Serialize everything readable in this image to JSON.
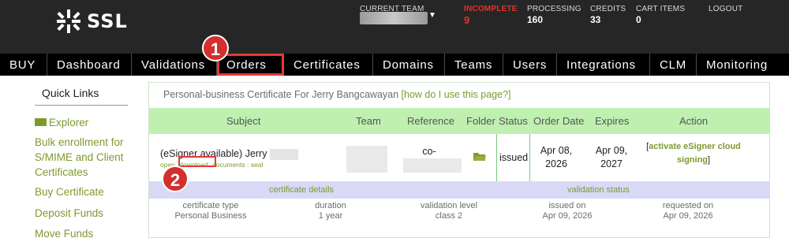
{
  "header": {
    "logo_text": "SSL",
    "current_team_label": "CURRENT TEAM",
    "incomplete_label": "INCOMPLETE",
    "incomplete_value": "9",
    "processing_label": "PROCESSING",
    "processing_value": "160",
    "credits_label": "CREDITS",
    "credits_value": "33",
    "cart_label": "CART ITEMS",
    "cart_value": "0",
    "logout_label": "LOGOUT",
    "incomplete_color": "#e3322b"
  },
  "nav": {
    "items": [
      "BUY",
      "Dashboard",
      "Validations",
      "Orders",
      "Certificates",
      "Domains",
      "Teams",
      "Users",
      "Integrations",
      "CLM",
      "Monitoring"
    ],
    "active": "Orders"
  },
  "callouts": [
    "1",
    "2"
  ],
  "sidebar": {
    "title": "Quick Links",
    "links": [
      "Explorer",
      "Bulk enrollment for S/MIME and Client Certificates",
      "Buy Certificate",
      "Deposit Funds",
      "Move Funds"
    ],
    "explorer_icon": "folder-open-icon"
  },
  "panel": {
    "title": "Personal-business Certificate For Jerry Bangcawayan",
    "help_link": "[how do I use this page?]",
    "columns": [
      "Subject",
      "Team",
      "Reference",
      "Folder",
      "Status",
      "Order Date",
      "Expires",
      "Action"
    ],
    "row": {
      "subject": "(eSigner available) Jerry",
      "link_open": "open",
      "link_download": "download",
      "link_documents": "documents : seal",
      "reference": "co-",
      "folder_icon": "folder-icon",
      "status": "issued",
      "order_date": "Apr 08, 2026",
      "expires": "Apr 09, 2027",
      "action": "activate eSigner cloud signing"
    },
    "details": {
      "cert_details_label": "certificate details",
      "validation_status_label": "validation status",
      "fields": [
        {
          "label": "certificate type",
          "value": "Personal Business"
        },
        {
          "label": "duration",
          "value": "1 year"
        },
        {
          "label": "validation level",
          "value": "class 2"
        },
        {
          "label": "issued on",
          "value": "Apr 09, 2026"
        },
        {
          "label": "requested on",
          "value": "Apr 09, 2026"
        }
      ]
    }
  },
  "colors": {
    "accent_green": "#7e9a2f",
    "header_bg": "#262626",
    "table_header_bg": "#bff0b0",
    "details_bg": "#d9d9f7",
    "callout_red": "#d32f2f"
  }
}
